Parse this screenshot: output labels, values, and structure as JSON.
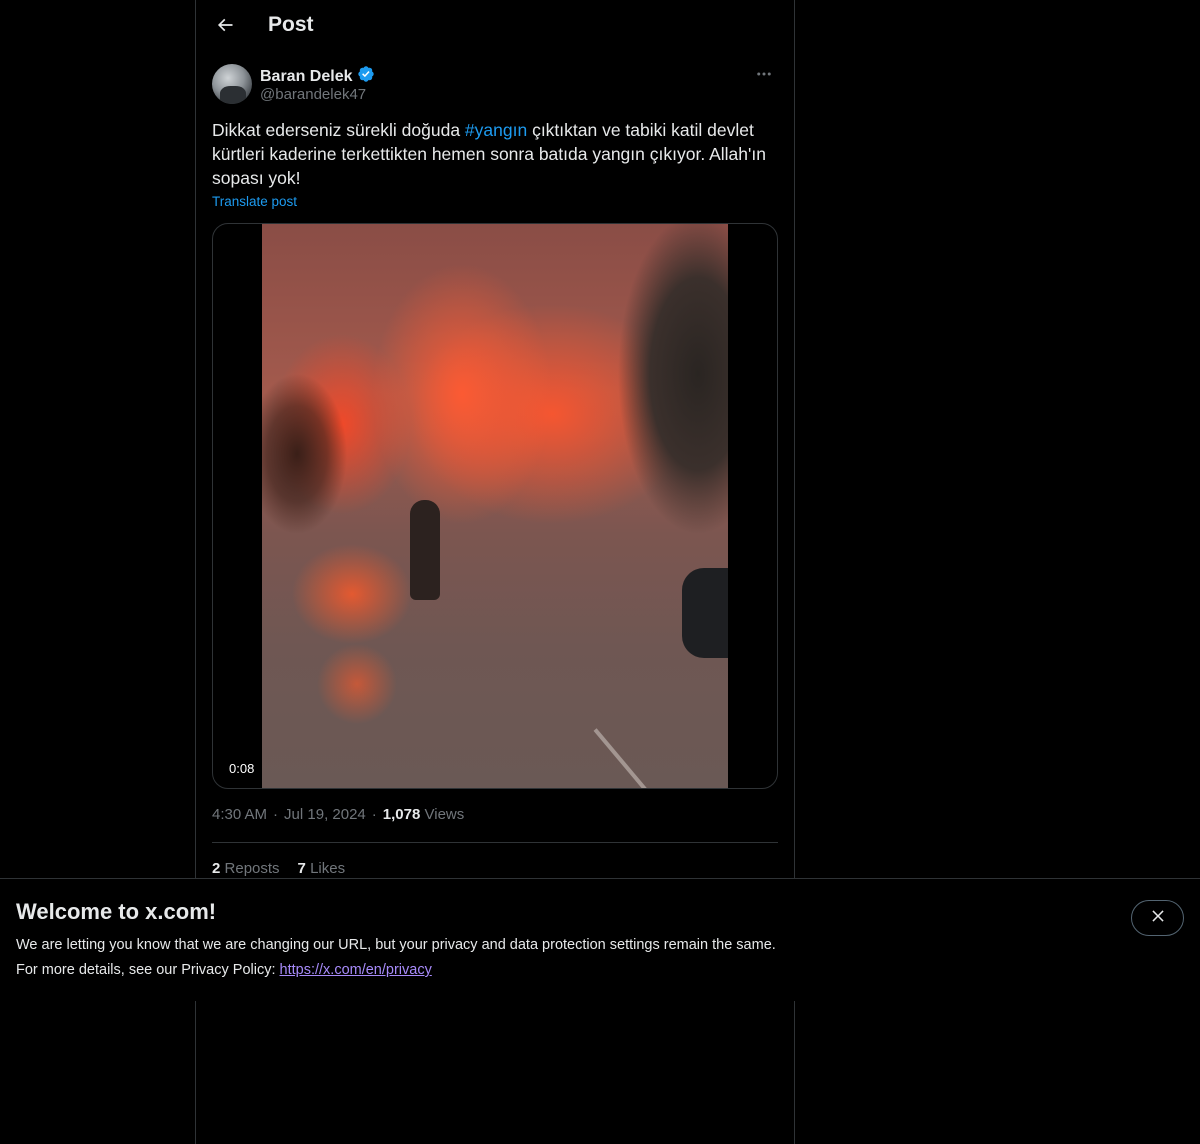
{
  "header": {
    "title": "Post",
    "back_icon": "arrow-left-icon"
  },
  "post": {
    "author": {
      "name": "Baran Delek",
      "handle": "@barandelek47",
      "verified": true,
      "verified_color": "#1d9bf0"
    },
    "text_before": "Dikkat ederseniz sürekli doğuda ",
    "hashtag": "#yangın",
    "text_after": " çıktıktan ve tabiki katil devlet kürtleri kaderine terkettikten hemen sonra batıda yangın çıkıyor. Allah'ın sopası yok!",
    "translate_label": "Translate post",
    "video": {
      "duration": "0:08"
    },
    "time": "4:30 AM",
    "separator": "·",
    "date": "Jul 19, 2024",
    "views_count": "1,078",
    "views_label": "Views",
    "reposts_count": "2",
    "reposts_label": "Reposts",
    "likes_count": "7",
    "likes_label": "Likes"
  },
  "banner": {
    "title": "Welcome to x.com!",
    "line1": "We are letting you know that we are changing our URL, but your privacy and data protection settings remain the same.",
    "line2_prefix": "For more details, see our Privacy Policy: ",
    "privacy_link": "https://x.com/en/privacy",
    "close_icon": "close-icon"
  },
  "colors": {
    "background": "#000000",
    "text": "#e7e9ea",
    "secondary_text": "#71767b",
    "accent": "#1d9bf0",
    "border": "#2f3336"
  }
}
